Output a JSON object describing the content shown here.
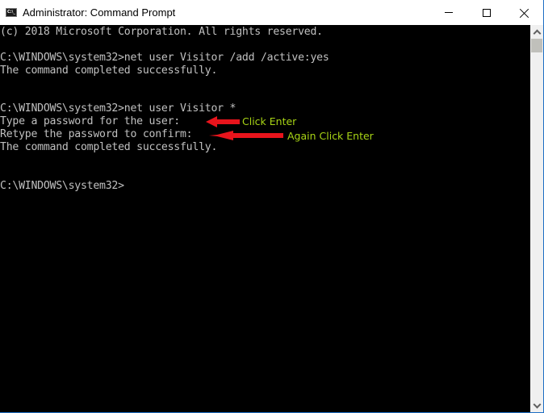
{
  "window": {
    "title": "Administrator: Command Prompt",
    "controls": {
      "minimize": "minimize",
      "maximize": "maximize",
      "close": "close"
    }
  },
  "console": {
    "lines": [
      "(c) 2018 Microsoft Corporation. All rights reserved.",
      "",
      "C:\\WINDOWS\\system32>net user Visitor /add /active:yes",
      "The command completed successfully.",
      "",
      "",
      "C:\\WINDOWS\\system32>net user Visitor *",
      "Type a password for the user:",
      "Retype the password to confirm:",
      "The command completed successfully.",
      "",
      "",
      "C:\\WINDOWS\\system32>"
    ]
  },
  "annotations": [
    {
      "label": "Click Enter",
      "color": "#a8d415",
      "arrow_color": "#e8141c"
    },
    {
      "label": "Again Click Enter",
      "color": "#a8d415",
      "arrow_color": "#e8141c"
    }
  ],
  "scrollbar": {
    "position": "top"
  }
}
